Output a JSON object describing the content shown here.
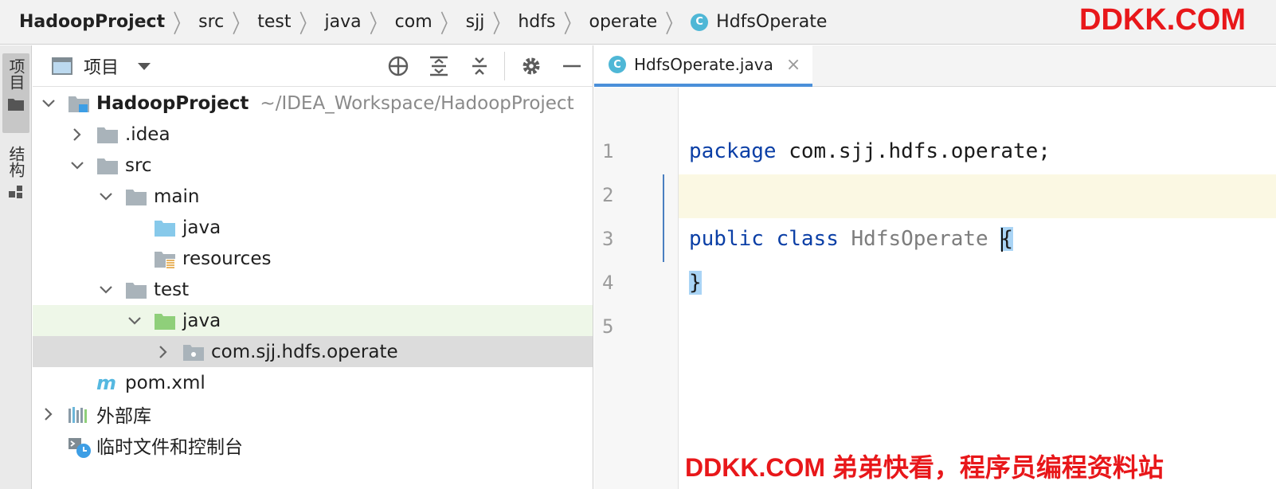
{
  "breadcrumb": {
    "items": [
      "HadoopProject",
      "src",
      "test",
      "java",
      "com",
      "sjj",
      "hdfs",
      "operate"
    ],
    "current": {
      "icon_letter": "C",
      "label": "HdfsOperate"
    }
  },
  "watermarks": {
    "top": "DDKK.COM",
    "bottom": "DDKK.COM 弟弟快看，程序员编程资料站",
    "color": "#e8171a"
  },
  "tool_strip": {
    "project_label": "项目",
    "structure_label": "结构"
  },
  "project_panel": {
    "view_label": "项目",
    "toolbar_icons": [
      "locate-icon",
      "expand-all-icon",
      "collapse-all-icon",
      "gear-icon",
      "hide-icon"
    ],
    "tree": [
      {
        "label": "HadoopProject",
        "hint": "~/IDEA_Workspace/HadoopProject",
        "icon": "module-folder-icon",
        "state": "expanded"
      },
      {
        "label": ".idea",
        "icon": "folder-icon",
        "state": "collapsed"
      },
      {
        "label": "src",
        "icon": "folder-icon",
        "state": "expanded"
      },
      {
        "label": "main",
        "icon": "folder-icon",
        "state": "expanded"
      },
      {
        "label": "java",
        "icon": "source-root-folder-icon",
        "state": "leaf"
      },
      {
        "label": "resources",
        "icon": "resources-folder-icon",
        "state": "leaf"
      },
      {
        "label": "test",
        "icon": "folder-icon",
        "state": "expanded"
      },
      {
        "label": "java",
        "icon": "test-root-folder-icon",
        "state": "expanded"
      },
      {
        "label": "com.sjj.hdfs.operate",
        "icon": "package-icon",
        "state": "collapsed"
      },
      {
        "label": "pom.xml",
        "icon": "maven-icon",
        "state": "leaf"
      },
      {
        "label": "外部库",
        "icon": "library-icon",
        "state": "collapsed"
      },
      {
        "label": "临时文件和控制台",
        "icon": "scratch-icon",
        "state": "leaf"
      }
    ]
  },
  "editor": {
    "tab": {
      "icon_letter": "C",
      "label": "HdfsOperate.java",
      "close": "×"
    },
    "lines": [
      "1",
      "2",
      "3",
      "4",
      "5"
    ],
    "code": {
      "package_kw": "package",
      "package_name": " com.sjj.hdfs.operate;",
      "public_kw": "public",
      "class_kw": "class",
      "class_name": "HdfsOperate",
      "open_brace": "{",
      "close_brace": "}"
    }
  },
  "colors": {
    "keyword": "#0b3fa6",
    "tab_underline": "#4a8fd9",
    "caret_row": "#fbf8e3",
    "selection": "#dcdcdc",
    "test_folder": "#8fcf7a",
    "source_folder": "#87c9ea"
  }
}
